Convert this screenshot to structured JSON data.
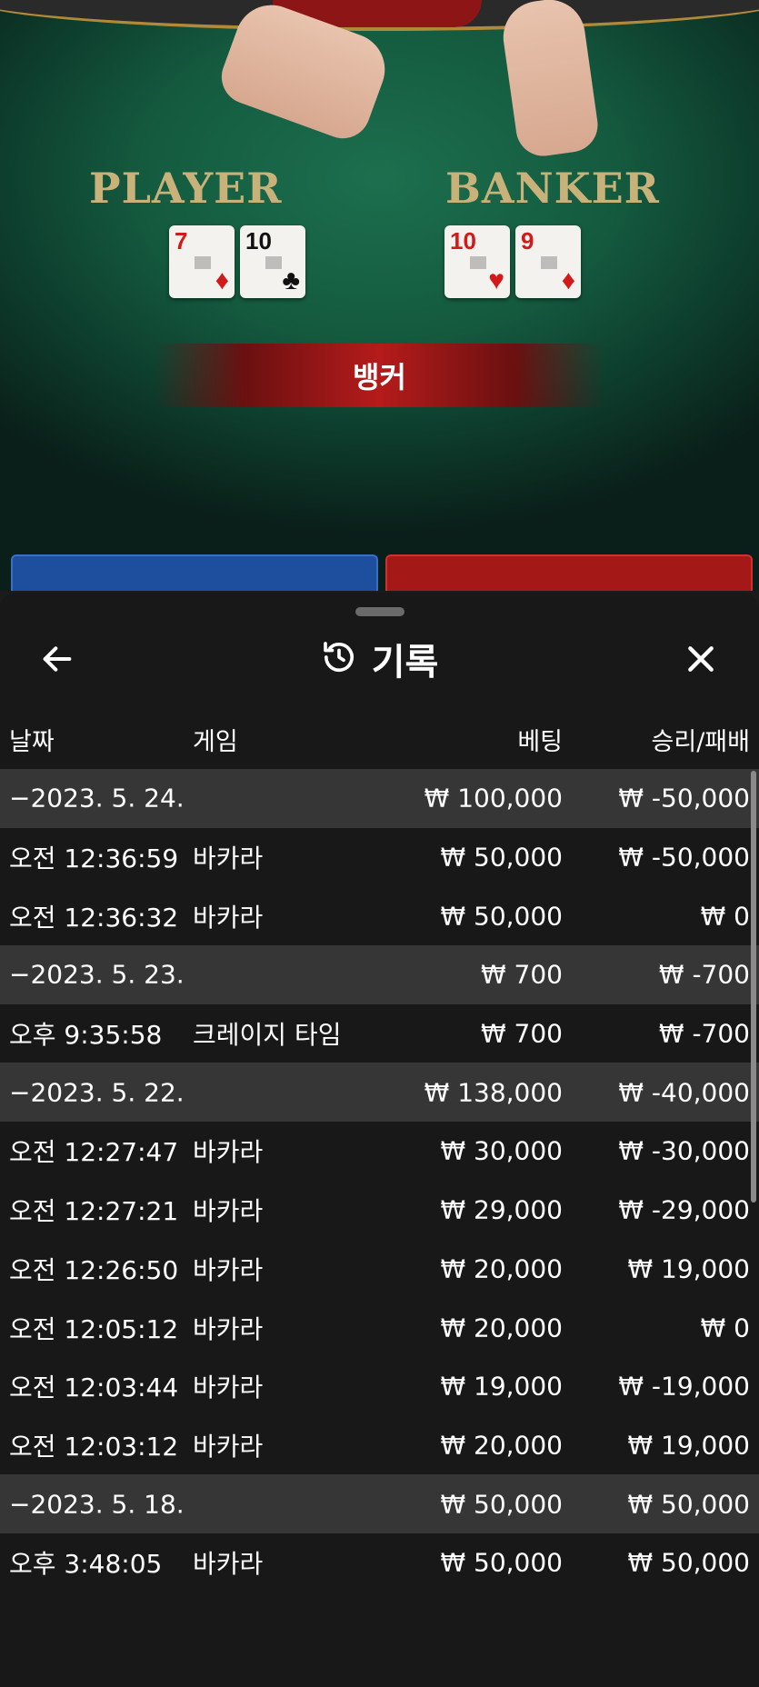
{
  "table": {
    "player_label": "PLAYER",
    "banker_label": "BANKER",
    "result_banner": "뱅커",
    "player_cards": [
      {
        "rank": "7",
        "suit": "♦",
        "color": "red"
      },
      {
        "rank": "10",
        "suit": "♣",
        "color": "black"
      }
    ],
    "banker_cards": [
      {
        "rank": "10",
        "suit": "♥",
        "color": "red"
      },
      {
        "rank": "9",
        "suit": "♦",
        "color": "red"
      }
    ]
  },
  "header": {
    "title": "기록",
    "history_icon": "history-icon",
    "back_icon": "arrow-left-icon",
    "close_icon": "close-icon"
  },
  "columns": {
    "date": "날짜",
    "game": "게임",
    "bet": "베팅",
    "result": "승리/패배"
  },
  "rows": [
    {
      "type": "group",
      "date": "−2023. 5. 24.",
      "game": "",
      "bet": "₩ 100,000",
      "result": "₩ -50,000"
    },
    {
      "type": "item",
      "date": "오전 12:36:59",
      "game": "바카라",
      "bet": "₩ 50,000",
      "result": "₩ -50,000"
    },
    {
      "type": "item",
      "date": "오전 12:36:32",
      "game": "바카라",
      "bet": "₩ 50,000",
      "result": "₩ 0"
    },
    {
      "type": "group",
      "date": "−2023. 5. 23.",
      "game": "",
      "bet": "₩ 700",
      "result": "₩ -700"
    },
    {
      "type": "item",
      "date": "오후 9:35:58",
      "game": "크레이지 타임",
      "bet": "₩ 700",
      "result": "₩ -700"
    },
    {
      "type": "group",
      "date": "−2023. 5. 22.",
      "game": "",
      "bet": "₩ 138,000",
      "result": "₩ -40,000"
    },
    {
      "type": "item",
      "date": "오전 12:27:47",
      "game": "바카라",
      "bet": "₩ 30,000",
      "result": "₩ -30,000"
    },
    {
      "type": "item",
      "date": "오전 12:27:21",
      "game": "바카라",
      "bet": "₩ 29,000",
      "result": "₩ -29,000"
    },
    {
      "type": "item",
      "date": "오전 12:26:50",
      "game": "바카라",
      "bet": "₩ 20,000",
      "result": "₩ 19,000"
    },
    {
      "type": "item",
      "date": "오전 12:05:12",
      "game": "바카라",
      "bet": "₩ 20,000",
      "result": "₩ 0"
    },
    {
      "type": "item",
      "date": "오전 12:03:44",
      "game": "바카라",
      "bet": "₩ 19,000",
      "result": "₩ -19,000"
    },
    {
      "type": "item",
      "date": "오전 12:03:12",
      "game": "바카라",
      "bet": "₩ 20,000",
      "result": "₩ 19,000"
    },
    {
      "type": "group",
      "date": "−2023. 5. 18.",
      "game": "",
      "bet": "₩ 50,000",
      "result": "₩ 50,000"
    },
    {
      "type": "item",
      "date": "오후 3:48:05",
      "game": "바카라",
      "bet": "₩ 50,000",
      "result": "₩ 50,000"
    }
  ]
}
